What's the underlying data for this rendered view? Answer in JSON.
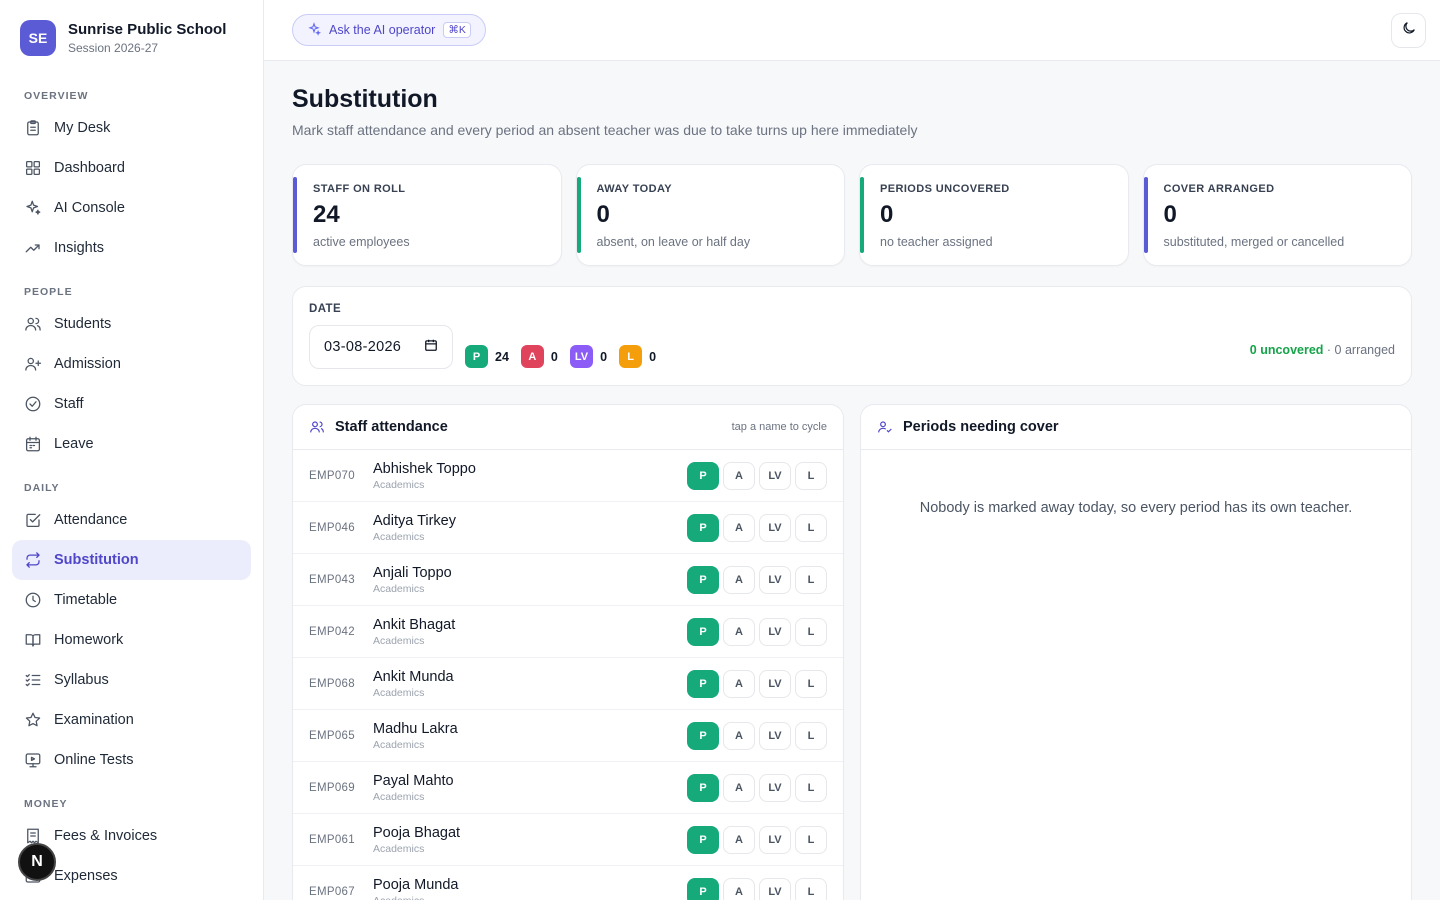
{
  "brand": {
    "initials": "SE",
    "name": "Sunrise Public School",
    "session": "Session 2026-27"
  },
  "sidebar": {
    "sections": [
      {
        "heading": "OVERVIEW",
        "items": [
          {
            "label": "My Desk",
            "icon": "clipboard-icon"
          },
          {
            "label": "Dashboard",
            "icon": "grid-icon"
          },
          {
            "label": "AI Console",
            "icon": "sparkle-icon"
          },
          {
            "label": "Insights",
            "icon": "trending-up-icon"
          }
        ]
      },
      {
        "heading": "PEOPLE",
        "items": [
          {
            "label": "Students",
            "icon": "users-icon"
          },
          {
            "label": "Admission",
            "icon": "user-plus-icon"
          },
          {
            "label": "Staff",
            "icon": "check-circle-icon"
          },
          {
            "label": "Leave",
            "icon": "calendar-icon"
          }
        ]
      },
      {
        "heading": "DAILY",
        "items": [
          {
            "label": "Attendance",
            "icon": "check-square-icon"
          },
          {
            "label": "Substitution",
            "icon": "repeat-icon",
            "active": true
          },
          {
            "label": "Timetable",
            "icon": "clock-icon"
          },
          {
            "label": "Homework",
            "icon": "book-open-icon"
          },
          {
            "label": "Syllabus",
            "icon": "list-checks-icon"
          },
          {
            "label": "Examination",
            "icon": "star-icon"
          },
          {
            "label": "Online Tests",
            "icon": "monitor-icon"
          }
        ]
      },
      {
        "heading": "MONEY",
        "items": [
          {
            "label": "Fees & Invoices",
            "icon": "receipt-icon"
          },
          {
            "label": "Expenses",
            "icon": "wallet-icon"
          }
        ]
      }
    ]
  },
  "fab": {
    "letter": "N"
  },
  "topbar": {
    "ask_label": "Ask the AI operator",
    "shortcut": "⌘K"
  },
  "page": {
    "title": "Substitution",
    "subtitle": "Mark staff attendance and every period an absent teacher was due to take turns up here immediately"
  },
  "stats": [
    {
      "label": "STAFF ON ROLL",
      "value": "24",
      "sub": "active employees",
      "color": "#5b5bd6"
    },
    {
      "label": "AWAY TODAY",
      "value": "0",
      "sub": "absent, on leave or half day",
      "color": "#16a97a"
    },
    {
      "label": "PERIODS UNCOVERED",
      "value": "0",
      "sub": "no teacher assigned",
      "color": "#16a97a"
    },
    {
      "label": "COVER ARRANGED",
      "value": "0",
      "sub": "substituted, merged or cancelled",
      "color": "#5b5bd6"
    }
  ],
  "date_filter": {
    "label": "DATE",
    "value": "03-08-2026",
    "counts": [
      {
        "tag": "P",
        "count": "24",
        "color": "#16a97a"
      },
      {
        "tag": "A",
        "count": "0",
        "color": "#e0435c"
      },
      {
        "tag": "LV",
        "count": "0",
        "color": "#8b5cf6"
      },
      {
        "tag": "L",
        "count": "0",
        "color": "#f59e0b"
      }
    ],
    "uncovered": "0 uncovered",
    "arranged": " · 0 arranged"
  },
  "attendance": {
    "title": "Staff attendance",
    "hint": "tap a name to cycle",
    "status_options": [
      "P",
      "A",
      "LV",
      "L"
    ],
    "rows": [
      {
        "id": "EMP070",
        "name": "Abhishek Toppo",
        "dept": "Academics",
        "status": "P"
      },
      {
        "id": "EMP046",
        "name": "Aditya Tirkey",
        "dept": "Academics",
        "status": "P"
      },
      {
        "id": "EMP043",
        "name": "Anjali Toppo",
        "dept": "Academics",
        "status": "P"
      },
      {
        "id": "EMP042",
        "name": "Ankit Bhagat",
        "dept": "Academics",
        "status": "P"
      },
      {
        "id": "EMP068",
        "name": "Ankit Munda",
        "dept": "Academics",
        "status": "P"
      },
      {
        "id": "EMP065",
        "name": "Madhu Lakra",
        "dept": "Academics",
        "status": "P"
      },
      {
        "id": "EMP069",
        "name": "Payal Mahto",
        "dept": "Academics",
        "status": "P"
      },
      {
        "id": "EMP061",
        "name": "Pooja Bhagat",
        "dept": "Academics",
        "status": "P"
      },
      {
        "id": "EMP067",
        "name": "Pooja Munda",
        "dept": "Academics",
        "status": "P"
      }
    ]
  },
  "cover": {
    "title": "Periods needing cover",
    "empty_message": "Nobody is marked away today, so every period has its own teacher."
  }
}
